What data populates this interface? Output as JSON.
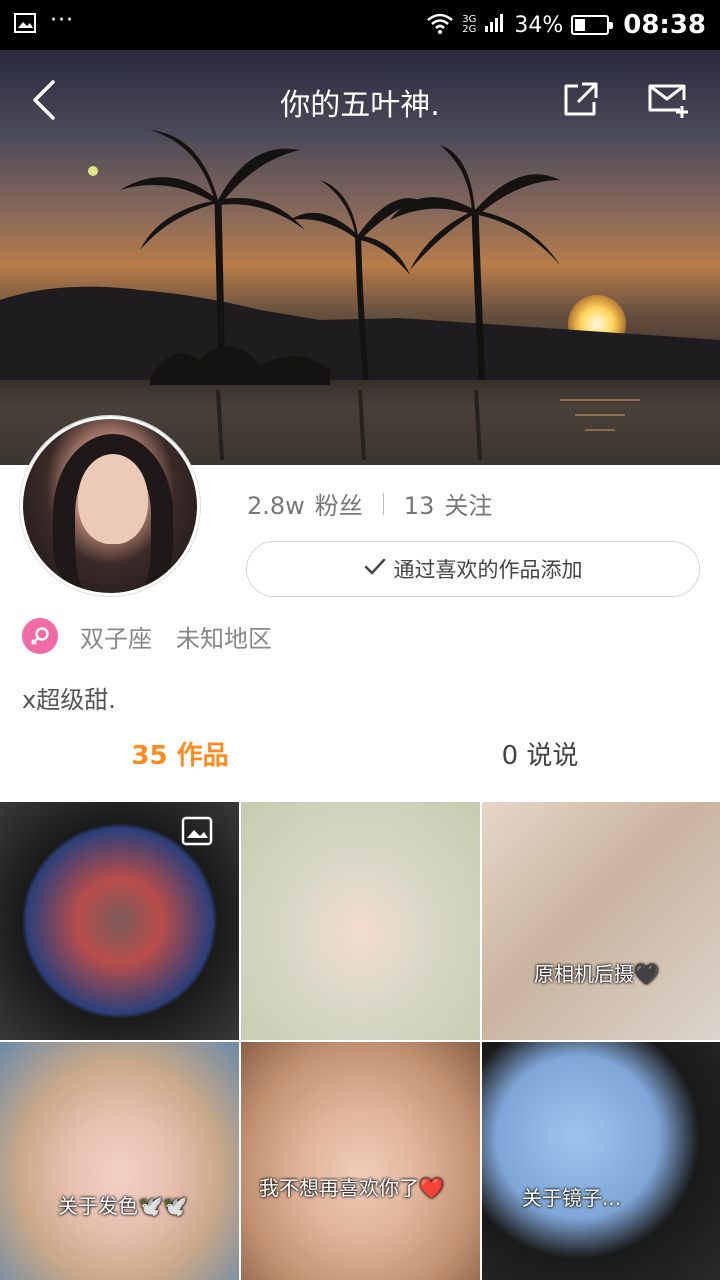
{
  "status_bar": {
    "network_top": "3G",
    "network_bottom": "2G",
    "battery_pct": "34%",
    "battery_level": 0.34,
    "time": "08:38"
  },
  "header": {
    "title": "你的五叶神.",
    "icons": [
      "back-icon",
      "share-icon",
      "mail-add-icon"
    ]
  },
  "profile": {
    "fans_count": "2.8w",
    "fans_label": "粉丝",
    "follow_count": "13",
    "follow_label": "关注",
    "like_button_label": "通过喜欢的作品添加",
    "gender_color": "#f26aa6",
    "zodiac": "双子座",
    "location": "未知地区",
    "bio": "x超级甜."
  },
  "tabs": [
    {
      "label": "35 作品",
      "active": true
    },
    {
      "label": "0 说说",
      "active": false
    }
  ],
  "accent_color": "#ff8a1e",
  "grid": [
    {
      "caption": ""
    },
    {
      "caption": ""
    },
    {
      "caption": "原相机后摄🖤"
    },
    {
      "caption": "关于发色🕊️🕊️"
    },
    {
      "caption": "我不想再喜欢你了❤️"
    },
    {
      "caption": "关于镜子..."
    }
  ]
}
